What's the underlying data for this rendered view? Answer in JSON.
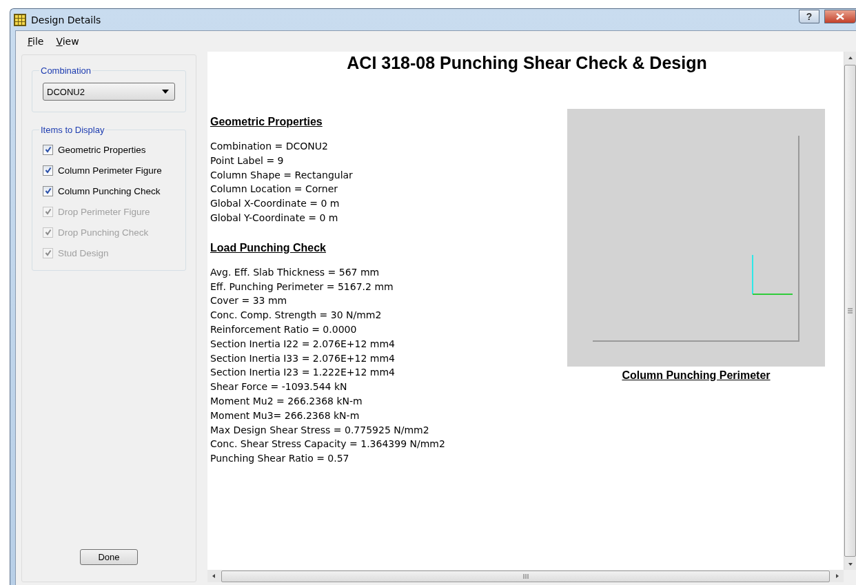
{
  "window": {
    "title": "Design Details",
    "help": "?"
  },
  "menu": [
    {
      "label": "File"
    },
    {
      "label": "View"
    }
  ],
  "sidebar": {
    "combination": {
      "legend": "Combination",
      "value": "DCONU2"
    },
    "display": {
      "legend": "Items to Display",
      "items": [
        {
          "label": "Geometric Properties",
          "checked": true,
          "disabled": false
        },
        {
          "label": "Column Perimeter Figure",
          "checked": true,
          "disabled": false
        },
        {
          "label": "Column Punching Check",
          "checked": true,
          "disabled": false
        },
        {
          "label": "Drop Perimeter Figure",
          "checked": true,
          "disabled": true
        },
        {
          "label": "Drop Punching Check",
          "checked": true,
          "disabled": true
        },
        {
          "label": "Stud Design",
          "checked": true,
          "disabled": true
        }
      ]
    },
    "done": "Done"
  },
  "report": {
    "title": "ACI 318-08 Punching Shear Check & Design",
    "sections": [
      {
        "heading": "Geometric Properties",
        "lines": [
          "Combination = DCONU2",
          "Point Label = 9",
          "Column Shape = Rectangular",
          "Column Location = Corner",
          "Global X-Coordinate = 0 m",
          "Global Y-Coordinate = 0 m"
        ]
      },
      {
        "heading": "Load Punching Check",
        "lines": [
          "Avg. Eff. Slab Thickness = 567 mm",
          "Eff. Punching Perimeter = 5167.2 mm",
          "Cover = 33 mm",
          "Conc. Comp. Strength = 30 N/mm2",
          "Reinforcement Ratio = 0.0000",
          "Section Inertia I22 = 2.076E+12 mm4",
          "Section Inertia I33 = 2.076E+12 mm4",
          "Section Inertia I23 = 1.222E+12 mm4",
          "Shear Force = -1093.544 kN",
          "Moment Mu2 = 266.2368 kN-m",
          "Moment Mu3= 266.2368 kN-m",
          "Max Design Shear Stress = 0.775925 N/mm2",
          "Conc. Shear Stress Capacity = 1.364399 N/mm2",
          "Punching Shear Ratio = 0.57"
        ]
      }
    ],
    "figure": {
      "caption": "Column Punching Perimeter"
    }
  }
}
